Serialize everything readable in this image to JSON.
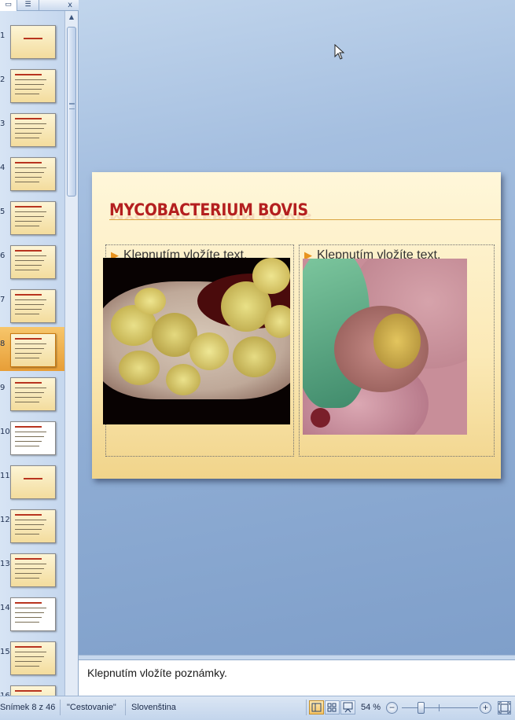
{
  "left_pane": {
    "close_label": "x",
    "slides": [
      {
        "number": "1"
      },
      {
        "number": "2"
      },
      {
        "number": "3"
      },
      {
        "number": "4"
      },
      {
        "number": "5"
      },
      {
        "number": "6"
      },
      {
        "number": "7"
      },
      {
        "number": "8",
        "selected": true
      },
      {
        "number": "9"
      },
      {
        "number": "10"
      },
      {
        "number": "11"
      },
      {
        "number": "12"
      },
      {
        "number": "13"
      },
      {
        "number": "14"
      },
      {
        "number": "15"
      },
      {
        "number": "16"
      }
    ]
  },
  "slide": {
    "title": "MYCOBACTERIUM BOVIS",
    "left_placeholder": "Klepnutím vložíte text.",
    "right_placeholder": "Klepnutím vložíte text.",
    "bullet": "▶"
  },
  "notes": {
    "placeholder": "Klepnutím vložíte poznámky."
  },
  "statusbar": {
    "slide_counter": "Snímek 8 z 46",
    "theme": "\"Cestovanie\"",
    "language": "Slovenština",
    "zoom_percent": "54 %",
    "zoom_minus": "−",
    "zoom_plus": "+"
  },
  "colors": {
    "title_red": "#b41f1f",
    "selection_orange": "#e79e37",
    "slide_background": "#fbe9b6"
  }
}
